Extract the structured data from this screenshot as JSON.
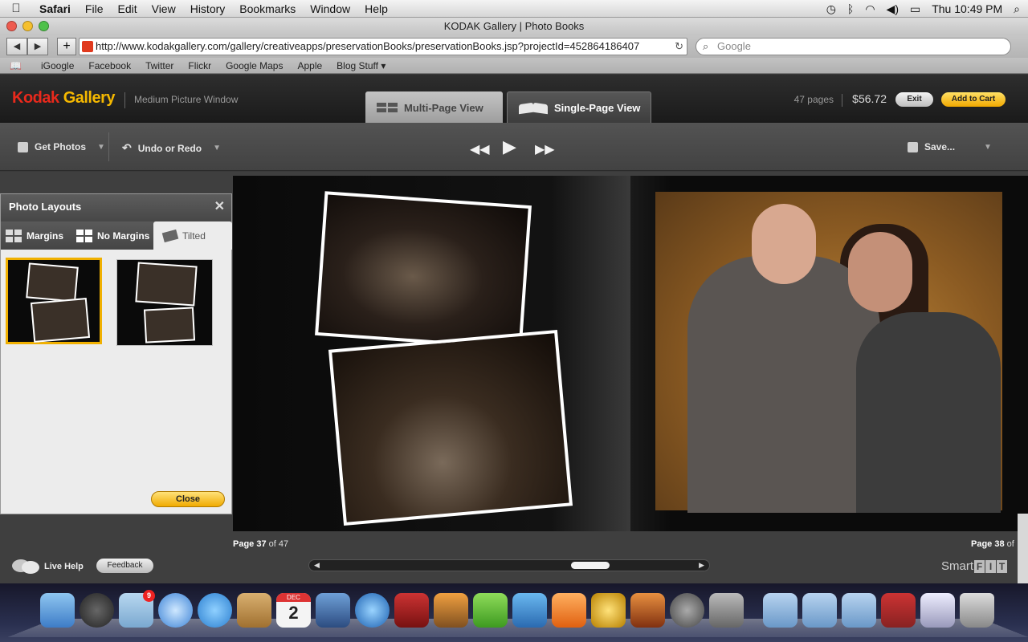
{
  "menubar": {
    "app": "Safari",
    "items": [
      "File",
      "Edit",
      "View",
      "History",
      "Bookmarks",
      "Window",
      "Help"
    ],
    "clock": "Thu 10:49 PM"
  },
  "browser": {
    "title": "KODAK Gallery | Photo Books",
    "url": "http://www.kodakgallery.com/gallery/creativeapps/preservationBooks/preservationBooks.jsp?projectId=452864186407",
    "search_placeholder": "Google",
    "bookmarks": [
      "iGoogle",
      "Facebook",
      "Twitter",
      "Flickr",
      "Google Maps",
      "Apple",
      "Blog Stuff ▾"
    ]
  },
  "header": {
    "logo_kodak": "Kodak",
    "logo_gallery": "Gallery",
    "window_label": "Medium Picture Window",
    "tab_multi": "Multi-Page View",
    "tab_single": "Single-Page View",
    "pages": "47 pages",
    "price": "$56.72",
    "exit": "Exit",
    "add_to_cart": "Add to Cart"
  },
  "toolbar": {
    "get_photos": "Get Photos",
    "undo_redo": "Undo or Redo",
    "save": "Save...",
    "prev": "◀◀",
    "play": "▶",
    "next": "▶▶"
  },
  "panel": {
    "title": "Photo Layouts",
    "tab_margins": "Margins",
    "tab_no_margins": "No Margins",
    "tab_tilted": "Tilted",
    "close": "Close"
  },
  "pages": {
    "left_word": "Page",
    "left_num": "37",
    "left_of": "of 47",
    "right_word": "Page",
    "right_num": "38",
    "right_of": "of"
  },
  "footer": {
    "live_help": "Live Help",
    "feedback": "Feedback",
    "smart": "Smart",
    "fit": [
      "F",
      "I",
      "T"
    ]
  },
  "dock": {
    "mail_badge": "9",
    "calendar_month": "DEC",
    "calendar_day": "2"
  }
}
